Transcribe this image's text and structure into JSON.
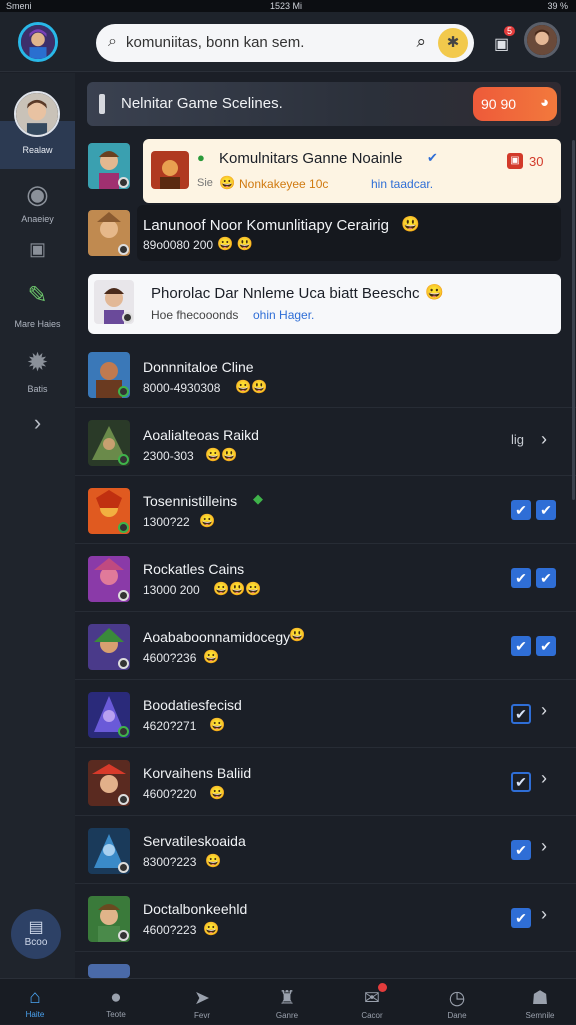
{
  "status_bar": {
    "left": "Smeni",
    "center": "1523 Mi",
    "right": "39 %"
  },
  "header": {
    "search_text": "komuniitas, bonn kan sem.",
    "notif_count": "5"
  },
  "sidebar": {
    "profile_label": "Realaw",
    "items": [
      {
        "label": "Anaeiey",
        "icon": "target-icon"
      },
      {
        "label": "Mare Haies",
        "icon": "pen-icon"
      },
      {
        "label": "Batis",
        "icon": "gear-icon"
      }
    ],
    "bottom_label": "Bcoo"
  },
  "banner": {
    "title": "Nelnitar Game Scelines.",
    "button": "90 90"
  },
  "rows": [
    {
      "title": "Komulnitars Ganne Noainle",
      "sub_gray": "Sie",
      "sub_orange": "Nonkakeyee 10c",
      "sub_blue": "hin taadcar.",
      "badge": "30",
      "style": "highlight"
    },
    {
      "title": "Lanunoof Noor Komunlitiapy Cerairig",
      "sub": "89o0080 200",
      "style": "dark"
    },
    {
      "title": "Phorolac Dar Nnleme Uca biatt Beeschc",
      "sub_gray": "Hoe fhecooonds",
      "sub_blue": "ohin Hager.",
      "style": "white"
    },
    {
      "title": "Donnnitaloe Cline",
      "sub": "8000-4930308",
      "end": "none"
    },
    {
      "title": "Aoalialteoas Raikd",
      "sub": "2300-303",
      "end": "text-arrow",
      "end_text": "lig"
    },
    {
      "title": "Tosennistilleins",
      "sub": "1300?22",
      "end": "double-check"
    },
    {
      "title": "Rockatles Cains",
      "sub": "13000 200",
      "end": "double-check"
    },
    {
      "title": "Aoababoonnamidocegy",
      "sub": "4600?236",
      "end": "double-check"
    },
    {
      "title": "Boodatiesfecisd",
      "sub": "4620?271",
      "end": "outline-arrow"
    },
    {
      "title": "Korvaihens Baliid",
      "sub": "4600?220",
      "end": "outline-arrow"
    },
    {
      "title": "Servatileskoaida",
      "sub": "8300?223",
      "end": "check-arrow"
    },
    {
      "title": "Doctalbonkeehld",
      "sub": "4600?223",
      "end": "check-arrow"
    }
  ],
  "bottom_nav": [
    {
      "label": "Haite",
      "icon": "home-icon",
      "active": true
    },
    {
      "label": "Teote",
      "icon": "user-icon"
    },
    {
      "label": "Fevr",
      "icon": "send-icon"
    },
    {
      "label": "Ganre",
      "icon": "tower-icon"
    },
    {
      "label": "Cacor",
      "icon": "chat-icon"
    },
    {
      "label": "Dane",
      "icon": "clock-icon"
    },
    {
      "label": "Semnile",
      "icon": "profile-icon"
    }
  ],
  "colors": {
    "accent": "#2f6ed6",
    "banner_button": "#ef6a3b",
    "highlight_card": "#fdf4e3"
  }
}
